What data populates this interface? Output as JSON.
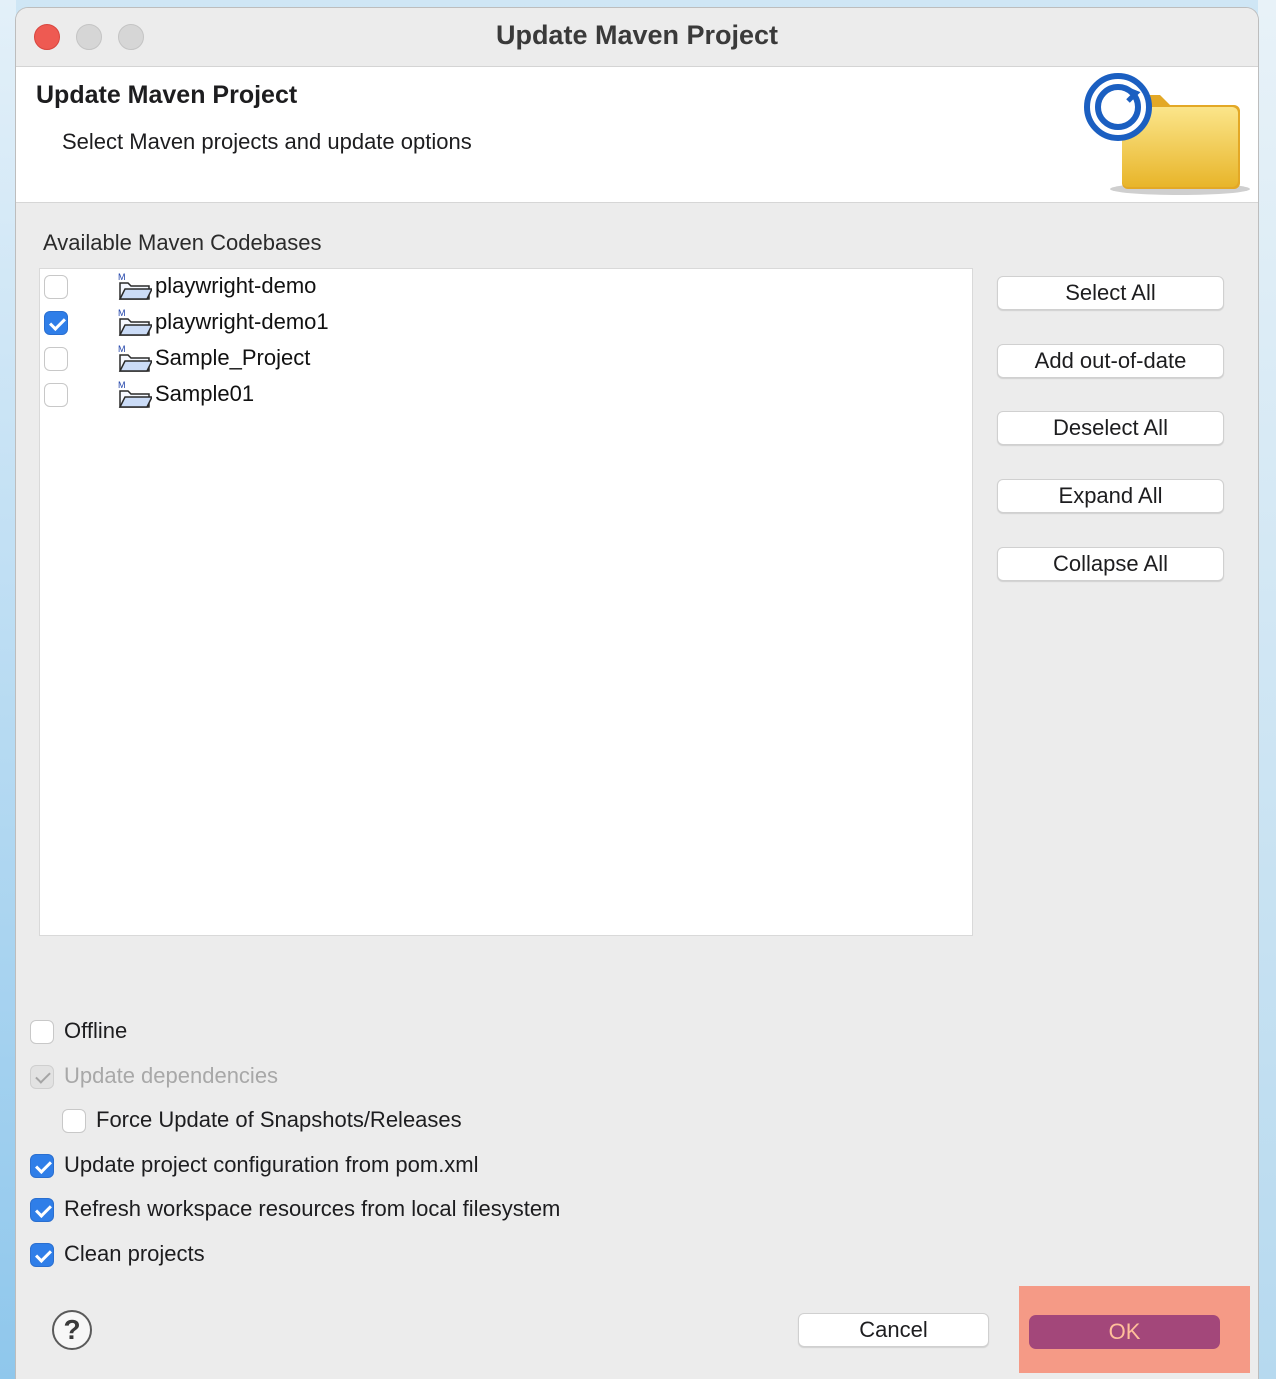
{
  "window": {
    "title": "Update Maven Project"
  },
  "header": {
    "title": "Update Maven Project",
    "description": "Select Maven projects and update options"
  },
  "codebases": {
    "label": "Available Maven Codebases",
    "items": [
      {
        "name": "playwright-demo",
        "checked": false
      },
      {
        "name": "playwright-demo1",
        "checked": true
      },
      {
        "name": "Sample_Project",
        "checked": false
      },
      {
        "name": "Sample01",
        "checked": false
      }
    ]
  },
  "side_buttons": {
    "select_all": "Select All",
    "add_out_of_date": "Add out-of-date",
    "deselect_all": "Deselect All",
    "expand_all": "Expand All",
    "collapse_all": "Collapse All"
  },
  "options": {
    "offline": {
      "label": "Offline",
      "checked": false
    },
    "update_dependencies": {
      "label": "Update dependencies",
      "checked": true,
      "disabled": true
    },
    "force_update": {
      "label": "Force Update of Snapshots/Releases",
      "checked": false
    },
    "update_config": {
      "label": "Update project configuration from pom.xml",
      "checked": true
    },
    "refresh_workspace": {
      "label": "Refresh workspace resources from local filesystem",
      "checked": true
    },
    "clean_projects": {
      "label": "Clean projects",
      "checked": true
    }
  },
  "footer": {
    "help": "?",
    "cancel_label": "Cancel",
    "ok_label": "OK"
  },
  "colors": {
    "accent": "#2f7ee8",
    "ok_button": "#a3477a",
    "ok_highlight": "#f59a86"
  }
}
